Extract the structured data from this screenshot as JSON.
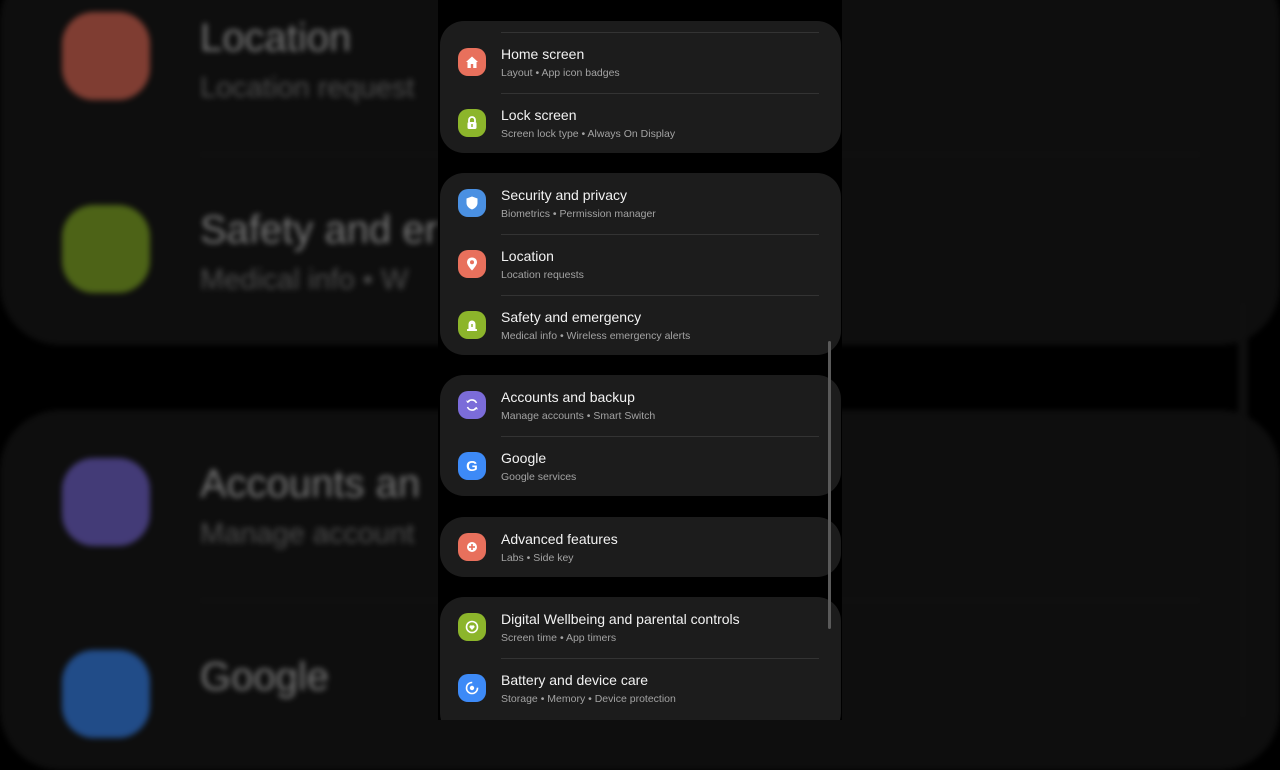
{
  "colors": {
    "home": "#e8705c",
    "lock": "#8cb52b",
    "security": "#4a90e2",
    "location": "#e8705c",
    "safety": "#8cb52b",
    "accounts": "#7b6cd9",
    "google": "#3d8af7",
    "advanced": "#e8705c",
    "wellbeing": "#8cb52b",
    "battery": "#3d8af7"
  },
  "background": {
    "location_title": "Location",
    "location_sub": "Location request",
    "safety_title": "Safety and er",
    "safety_sub": "Medical info  •  W",
    "accounts_title": "Accounts an",
    "accounts_sub": "Manage account",
    "google_title": "Google"
  },
  "groups": [
    {
      "items": [
        {
          "title": "Home screen",
          "subtitle": "Layout  •  App icon badges",
          "icon": "home-icon"
        },
        {
          "title": "Lock screen",
          "subtitle": "Screen lock type  •  Always On Display",
          "icon": "lock-icon"
        }
      ]
    },
    {
      "items": [
        {
          "title": "Security and privacy",
          "subtitle": "Biometrics  •  Permission manager",
          "icon": "shield-icon"
        },
        {
          "title": "Location",
          "subtitle": "Location requests",
          "icon": "location-pin-icon"
        },
        {
          "title": "Safety and emergency",
          "subtitle": "Medical info  •  Wireless emergency alerts",
          "icon": "siren-icon"
        }
      ]
    },
    {
      "items": [
        {
          "title": "Accounts and backup",
          "subtitle": "Manage accounts  •  Smart Switch",
          "icon": "sync-icon"
        },
        {
          "title": "Google",
          "subtitle": "Google services",
          "icon": "google-icon"
        }
      ]
    },
    {
      "items": [
        {
          "title": "Advanced features",
          "subtitle": "Labs  •  Side key",
          "icon": "gear-plus-icon"
        }
      ]
    },
    {
      "items": [
        {
          "title": "Digital Wellbeing and parental controls",
          "subtitle": "Screen time  •  App timers",
          "icon": "wellbeing-icon"
        },
        {
          "title": "Battery and device care",
          "subtitle": "Storage  •  Memory  •  Device protection",
          "icon": "battery-care-icon"
        }
      ]
    }
  ]
}
